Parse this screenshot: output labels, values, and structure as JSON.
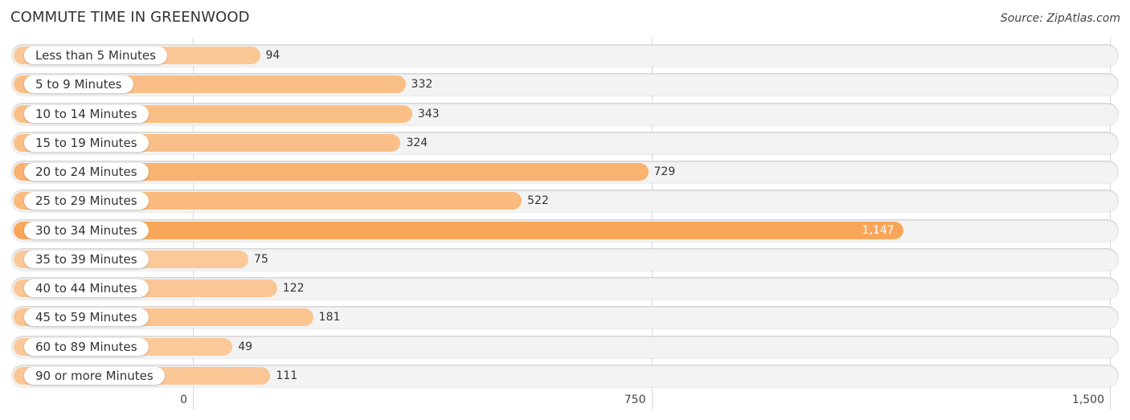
{
  "header": {
    "title": "COMMUTE TIME IN GREENWOOD",
    "source": "Source: ZipAtlas.com"
  },
  "chart_data": {
    "type": "bar",
    "orientation": "horizontal",
    "title": "COMMUTE TIME IN GREENWOOD",
    "xlabel": "",
    "ylabel": "",
    "categories": [
      "Less than 5 Minutes",
      "5 to 9 Minutes",
      "10 to 14 Minutes",
      "15 to 19 Minutes",
      "20 to 24 Minutes",
      "25 to 29 Minutes",
      "30 to 34 Minutes",
      "35 to 39 Minutes",
      "40 to 44 Minutes",
      "45 to 59 Minutes",
      "60 to 89 Minutes",
      "90 or more Minutes"
    ],
    "values": [
      94,
      332,
      343,
      324,
      729,
      522,
      1147,
      75,
      122,
      181,
      49,
      111
    ],
    "value_labels": [
      "94",
      "332",
      "343",
      "324",
      "729",
      "522",
      "1,147",
      "75",
      "122",
      "181",
      "49",
      "111"
    ],
    "xlim": [
      0,
      1500
    ],
    "ticks": [
      0,
      750,
      1500
    ],
    "tick_labels": [
      "0",
      "750",
      "1,500"
    ],
    "grid": true,
    "legend": "none",
    "colors": {
      "low": "#FBCB9E",
      "high": "#F9A65A",
      "track": "#F3F3F3"
    }
  }
}
